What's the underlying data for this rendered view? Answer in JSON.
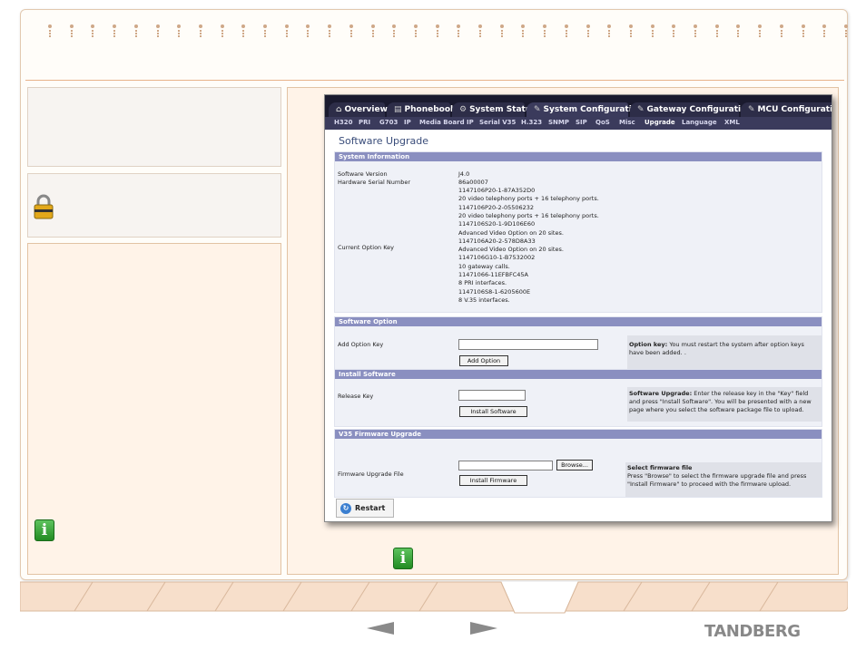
{
  "tabs": [
    {
      "label": "Overview",
      "icon": "house-icon"
    },
    {
      "label": "Phonebook",
      "icon": "book-icon"
    },
    {
      "label": "System Status",
      "icon": "gear-icon"
    },
    {
      "label": "System Configuration",
      "icon": "wrench-icon",
      "active": true
    },
    {
      "label": "Gateway Configuration",
      "icon": "wrench-icon"
    },
    {
      "label": "MCU Configuration",
      "icon": "wrench-icon"
    }
  ],
  "subtabs": [
    "H320",
    "PRI",
    "G703",
    "IP",
    "Media Board IP",
    "Serial V35",
    "H.323",
    "SNMP",
    "SIP",
    "QoS",
    "Misc",
    "Upgrade",
    "Language",
    "XML"
  ],
  "active_subtab": "Upgrade",
  "page_title": "Software Upgrade",
  "system_info": {
    "header": "System Information",
    "software_version_label": "Software Version",
    "software_version": "J4.0",
    "hardware_serial_label": "Hardware Serial Number",
    "hardware_serial": "86a00007",
    "current_option_key_label": "Current Option Key",
    "option_keys": [
      "1147106P20-1-87A352D0",
      "20 video telephony ports + 16 telephony ports.",
      "1147106P20-2-05506232",
      "20 video telephony ports + 16 telephony ports.",
      "1147106S20-1-9D106E60",
      "Advanced Video Option on 20 sites.",
      "1147106A20-2-578D8A33",
      "Advanced Video Option on 20 sites.",
      "1147106G10-1-B7532002",
      "10 gateway calls.",
      "11471066-11EFBFC45A",
      "8 PRI interfaces.",
      "1147106S8-1-6205600E",
      "8 V.35 interfaces."
    ]
  },
  "software_option": {
    "header": "Software Option",
    "add_option_key_label": "Add Option Key",
    "add_option_key_value": "",
    "add_option_button": "Add Option",
    "note_bold": "Option key:",
    "note_text": " You must restart the system after option keys have been added. ."
  },
  "install_software": {
    "header": "Install Software",
    "release_key_label": "Release Key",
    "release_key_value": "",
    "install_button": "Install Software",
    "note_bold": "Software Upgrade:",
    "note_text": " Enter the release key in the \"Key\" field and press \"Install Software\". You will be presented with a new page where you select the software package file to upload."
  },
  "v35_upgrade": {
    "header": "V35 Firmware Upgrade",
    "file_label": "Firmware Upgrade File",
    "file_value": "",
    "browse_button": "Browse...",
    "install_button": "Install Firmware",
    "note_bold": "Select firmware file",
    "note_text": "Press \"Browse\" to select the firmware upgrade file and press \"Install Firmware\" to proceed with the firmware upload."
  },
  "restart_label": "Restart",
  "nav": {
    "prev": "arrow-left-icon",
    "next": "arrow-right-icon"
  },
  "brand": "TANDBERG"
}
